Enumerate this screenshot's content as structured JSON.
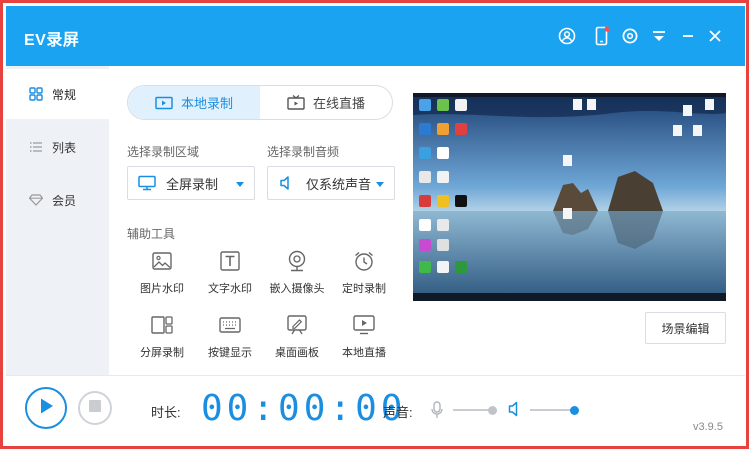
{
  "window": {
    "title": "EV录屏",
    "icons": [
      "user-icon",
      "phone-icon",
      "settings-icon",
      "menu-icon",
      "minimize-icon",
      "close-icon"
    ]
  },
  "sidebar": {
    "items": [
      {
        "label": "常规",
        "icon": "grid-icon",
        "active": true
      },
      {
        "label": "列表",
        "icon": "list-icon",
        "active": false
      },
      {
        "label": "会员",
        "icon": "diamond-icon",
        "active": false
      }
    ]
  },
  "tabs": [
    {
      "label": "本地录制",
      "icon": "record-icon",
      "active": true
    },
    {
      "label": "在线直播",
      "icon": "tv-icon",
      "active": false
    }
  ],
  "region": {
    "label": "选择录制区域",
    "value": "全屏录制"
  },
  "audio": {
    "label": "选择录制音频",
    "value": "仅系统声音"
  },
  "tools": {
    "label": "辅助工具",
    "items": [
      {
        "label": "图片水印",
        "icon": "image-icon"
      },
      {
        "label": "文字水印",
        "icon": "text-icon"
      },
      {
        "label": "嵌入摄像头",
        "icon": "webcam-icon"
      },
      {
        "label": "定时录制",
        "icon": "alarm-icon"
      },
      {
        "label": "分屏录制",
        "icon": "split-screen-icon"
      },
      {
        "label": "按键显示",
        "icon": "keyboard-icon"
      },
      {
        "label": "桌面画板",
        "icon": "drawing-board-icon"
      },
      {
        "label": "本地直播",
        "icon": "local-live-icon"
      }
    ]
  },
  "scene_button": "场景编辑",
  "bottom": {
    "duration_label": "时长:",
    "timer": [
      "00",
      "00",
      "00"
    ],
    "volume_label": "声音:",
    "mic_level": 0.9,
    "speaker_level": 1.0
  },
  "version": "v3.9.5",
  "colors": {
    "accent": "#19a3f0",
    "frame": "#e8423f"
  }
}
